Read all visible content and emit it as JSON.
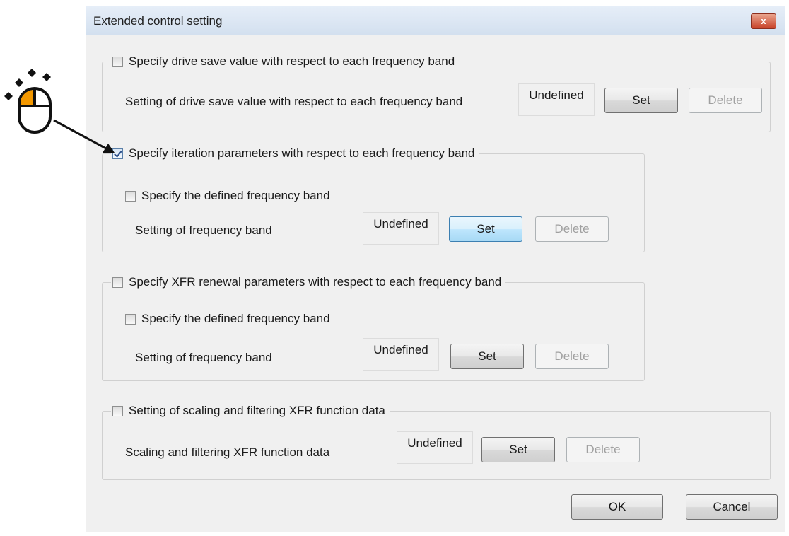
{
  "dialog": {
    "title": "Extended control setting",
    "close_glyph": "x"
  },
  "groups": [
    {
      "checkbox_label": "Specify drive save value with respect to each frequency band",
      "checked": false,
      "row_label": "Setting of drive save value with respect to each frequency band",
      "value": "Undefined",
      "set_label": "Set",
      "delete_label": "Delete"
    },
    {
      "checkbox_label": "Specify iteration parameters with respect to each frequency band",
      "checked": true,
      "sub_checkbox_label": "Specify the defined frequency band",
      "row_label": "Setting of frequency band",
      "value": "Undefined",
      "set_label": "Set",
      "delete_label": "Delete"
    },
    {
      "checkbox_label": "Specify XFR renewal parameters with respect to each frequency band",
      "checked": false,
      "sub_checkbox_label": "Specify the defined frequency band",
      "row_label": "Setting of frequency band",
      "value": "Undefined",
      "set_label": "Set",
      "delete_label": "Delete"
    },
    {
      "checkbox_label": "Setting of scaling and filtering XFR function data",
      "checked": false,
      "row_label": "Scaling and filtering XFR function data",
      "value": "Undefined",
      "set_label": "Set",
      "delete_label": "Delete"
    }
  ],
  "footer": {
    "ok_label": "OK",
    "cancel_label": "Cancel"
  },
  "annotation": {
    "icon": "mouse-click-icon",
    "accent_color": "#f39800"
  }
}
